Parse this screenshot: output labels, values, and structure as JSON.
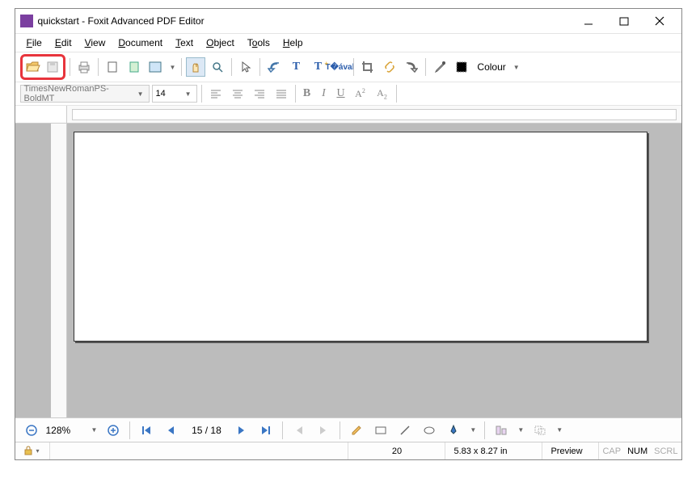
{
  "title": "quickstart - Foxit Advanced PDF Editor",
  "menu": {
    "file": "File",
    "edit": "Edit",
    "view": "View",
    "document": "Document",
    "text": "Text",
    "object": "Object",
    "tools": "Tools",
    "help": "Help"
  },
  "toolbar": {
    "colour_label": "Colour"
  },
  "format": {
    "font": "TimesNewRomanPS-BoldMT",
    "size": "14",
    "bold": "B",
    "italic": "I",
    "underline": "U",
    "super": "A",
    "sub": "A"
  },
  "nav": {
    "zoom": "128%",
    "page": "15 / 18"
  },
  "status": {
    "col": "20",
    "size": "5.83 x 8.27 in",
    "preview": "Preview",
    "cap": "CAP",
    "num": "NUM",
    "scrl": "SCRL"
  }
}
